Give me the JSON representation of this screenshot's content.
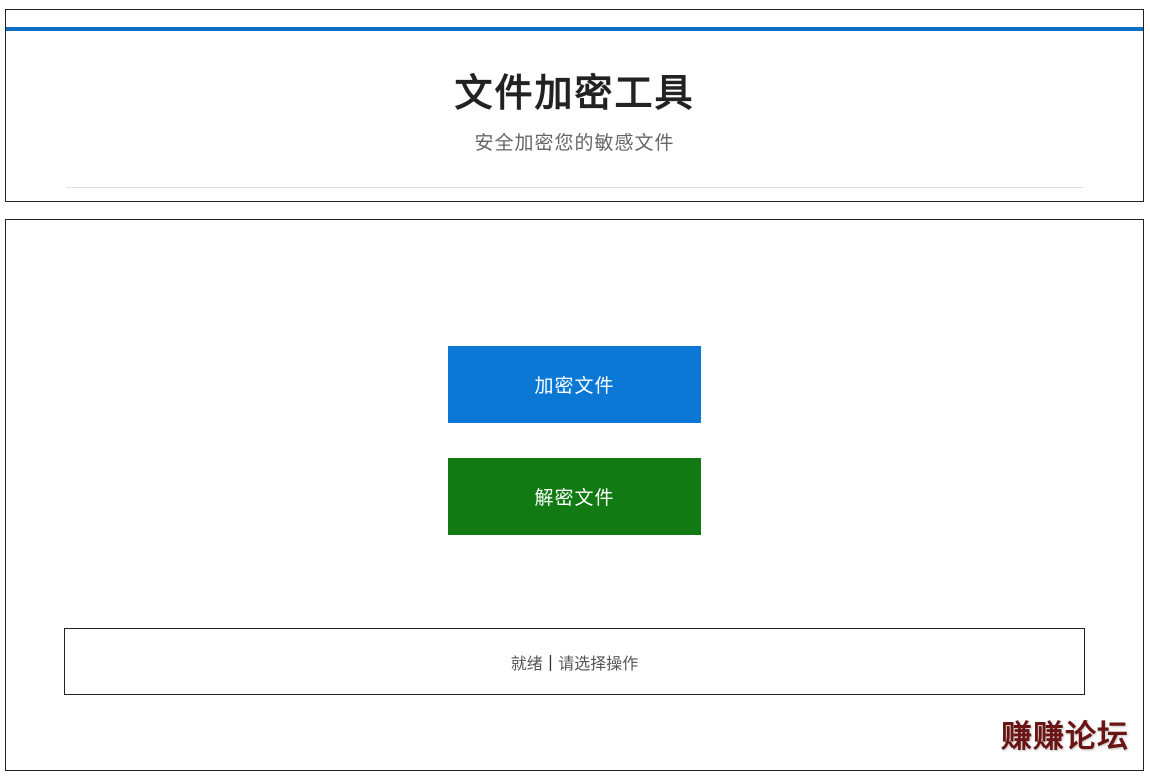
{
  "header": {
    "title": "文件加密工具",
    "subtitle": "安全加密您的敏感文件",
    "accent_color": "#0d6fc1"
  },
  "actions": {
    "encrypt_label": "加密文件",
    "encrypt_color": "#0b78d6",
    "decrypt_label": "解密文件",
    "decrypt_color": "#127a13"
  },
  "status": {
    "state": "就绪",
    "separator": "|",
    "message": "请选择操作"
  },
  "watermark": {
    "text": "赚赚论坛"
  }
}
